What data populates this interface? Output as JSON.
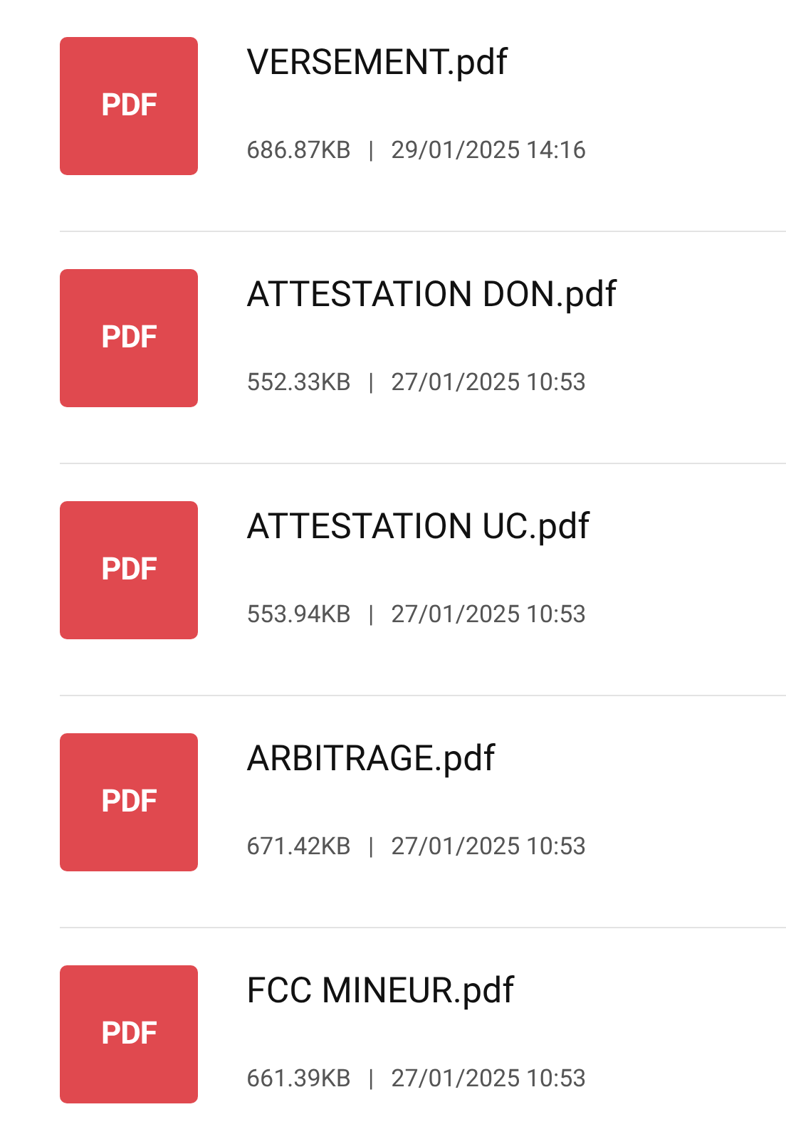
{
  "files": [
    {
      "badge": "PDF",
      "name": "VERSEMENT.pdf",
      "size": "686.87KB",
      "separator": "|",
      "date": "29/01/2025 14:16"
    },
    {
      "badge": "PDF",
      "name": "ATTESTATION DON.pdf",
      "size": "552.33KB",
      "separator": "|",
      "date": "27/01/2025 10:53"
    },
    {
      "badge": "PDF",
      "name": "ATTESTATION UC.pdf",
      "size": "553.94KB",
      "separator": "|",
      "date": "27/01/2025 10:53"
    },
    {
      "badge": "PDF",
      "name": "ARBITRAGE.pdf",
      "size": "671.42KB",
      "separator": "|",
      "date": "27/01/2025 10:53"
    },
    {
      "badge": "PDF",
      "name": "FCC MINEUR.pdf",
      "size": "661.39KB",
      "separator": "|",
      "date": "27/01/2025 10:53"
    }
  ]
}
